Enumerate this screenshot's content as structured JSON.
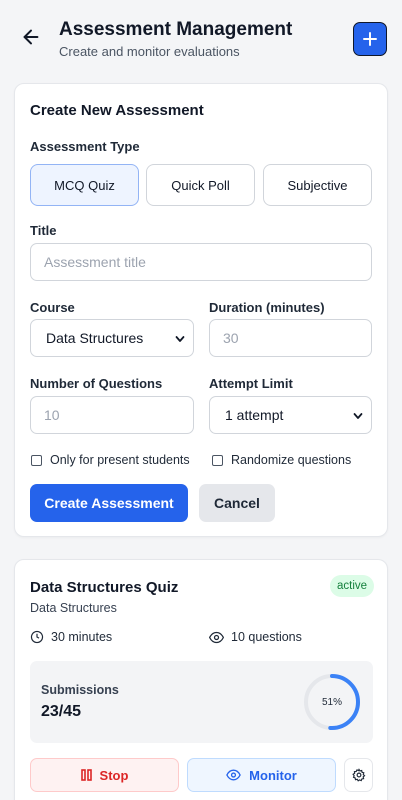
{
  "header": {
    "title": "Assessment Management",
    "subtitle": "Create and monitor evaluations",
    "back_icon": "arrow-left-icon",
    "add_icon": "plus-icon",
    "accent_color": "#2563eb"
  },
  "create_form": {
    "title": "Create New Assessment",
    "type_label": "Assessment Type",
    "types": [
      "MCQ Quiz",
      "Quick Poll",
      "Subjective"
    ],
    "selected_type": "MCQ Quiz",
    "title_label": "Title",
    "title_placeholder": "Assessment title",
    "course_label": "Course",
    "course_value": "Data Structures",
    "duration_label": "Duration (minutes)",
    "duration_placeholder": "30",
    "questions_label": "Number of Questions",
    "questions_placeholder": "10",
    "attempt_label": "Attempt Limit",
    "attempt_value": "1 attempt",
    "present_only_label": "Only for present students",
    "present_only_checked": false,
    "randomize_label": "Randomize questions",
    "randomize_checked": false,
    "create_label": "Create Assessment",
    "cancel_label": "Cancel"
  },
  "assessment": {
    "title": "Data Structures Quiz",
    "course": "Data Structures",
    "status": "active",
    "status_color": "#15803d",
    "duration": "30 minutes",
    "questions": "10 questions",
    "submissions_label": "Submissions",
    "submissions_value": "23/45",
    "progress_percent": 51,
    "progress_label": "51%",
    "stop_label": "Stop",
    "monitor_label": "Monitor",
    "stop_icon": "pause-icon",
    "monitor_icon": "eye-icon",
    "settings_icon": "gear-icon",
    "clock_icon": "clock-icon",
    "questions_icon": "eye-icon"
  }
}
